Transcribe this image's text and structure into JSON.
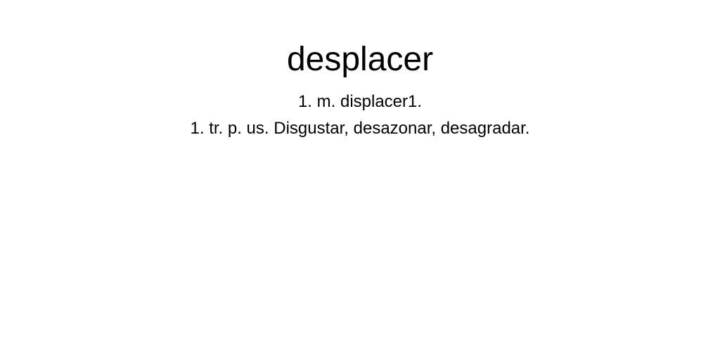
{
  "entry": {
    "headword": "desplacer",
    "definitions": [
      "1. m. displacer1.",
      "1. tr. p. us. Disgustar, desazonar, desagradar."
    ]
  }
}
